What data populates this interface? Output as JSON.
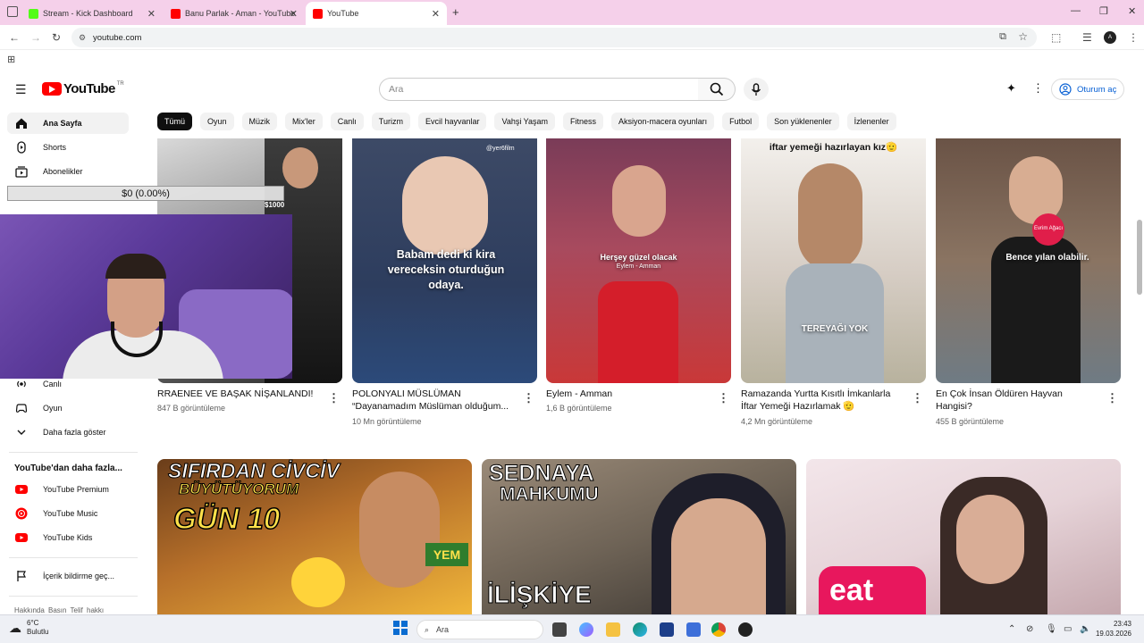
{
  "browser": {
    "tabs": [
      {
        "label": "Stream - Kick Dashboard",
        "favicon_color": "#53fc18",
        "active": false
      },
      {
        "label": "Banu Parlak - Aman - YouTube",
        "favicon_color": "#ff0000",
        "active": false
      },
      {
        "label": "YouTube",
        "favicon_color": "#ff0000",
        "active": true
      }
    ],
    "new_tab_icon": "plus-icon",
    "url": "youtube.com"
  },
  "header": {
    "logo_text": "YouTube",
    "country_code": "TR",
    "search_placeholder": "Ara",
    "sign_in_label": "Oturum aç"
  },
  "chips": [
    "Tümü",
    "Oyun",
    "Müzik",
    "Mix'ler",
    "Canlı",
    "Turizm",
    "Evcil hayvanlar",
    "Vahşi Yaşam",
    "Fitness",
    "Aksiyon-macera oyunları",
    "Futbol",
    "Son yüklenenler",
    "İzlenenler"
  ],
  "sidebar": {
    "top_items": [
      {
        "label": "Ana Sayfa",
        "icon": "home-icon"
      },
      {
        "label": "Shorts",
        "icon": "shorts-icon"
      },
      {
        "label": "Abonelikler",
        "icon": "subscriptions-icon"
      }
    ],
    "explore_items": [
      {
        "label": "Canlı",
        "icon": "live-icon"
      },
      {
        "label": "Oyun",
        "icon": "gaming-icon"
      },
      {
        "label": "Daha fazla göster",
        "icon": "chevron-down-icon"
      }
    ],
    "more_heading": "YouTube'dan daha fazla...",
    "more_items": [
      {
        "label": "YouTube Premium",
        "icon": "youtube-premium-icon"
      },
      {
        "label": "YouTube Music",
        "icon": "youtube-music-icon"
      },
      {
        "label": "YouTube Kids",
        "icon": "youtube-kids-icon"
      }
    ],
    "report_label": "İçerik bildirme geç...",
    "footer_links": "Hakkında  Basın  Telif hakkı"
  },
  "stream_overlay": {
    "donation_text": "$0 (0.00%)"
  },
  "videos_row1": [
    {
      "title": "RRAENEE VE BAŞAK NİŞANLANDI!",
      "views": "847 B görüntüleme",
      "overlay": "",
      "price": "$1000"
    },
    {
      "title": "POLONYALI MÜSLÜMAN “Dayanamadım Müslüman olduğum...",
      "views": "10 Mn görüntüleme",
      "overlay": "Babam dedi ki kira vereceksin oturduğun odaya.",
      "watermark": "@yer6film"
    },
    {
      "title": "Eylem - Amman",
      "views": "1,6 B görüntüleme",
      "overlay": "Herşey güzel olacak",
      "sub_overlay": "Eylem - Amman"
    },
    {
      "title": "Ramazanda Yurtta Kısıtlı İmkanlarla İftar Yemeği Hazırlamak 🫡",
      "views": "4,2 Mn görüntüleme",
      "overlay": "iftar yemeği hazırlayan kız🫡",
      "sub_overlay": "TEREYAĞI YOK"
    },
    {
      "title": "En Çok İnsan Öldüren Hayvan Hangisi?",
      "views": "455 B görüntüleme",
      "overlay": "Bence yılan olabilir.",
      "badge": "Evrim Ağacı"
    }
  ],
  "videos_row2": [
    {
      "overlay_lines": [
        "SIFIRDAN CİVCİV",
        "BÜYÜTÜYORUM",
        "GÜN 10"
      ],
      "sign": "YEM"
    },
    {
      "overlay_lines": [
        "SEDNAYA",
        "MAHKUMU",
        "İLİŞKİYE"
      ]
    },
    {
      "overlay_lines": [
        "eat"
      ]
    }
  ],
  "taskbar": {
    "weather_temp": "6°C",
    "weather_desc": "Bulutlu",
    "search_label": "Ara",
    "time": "23:43",
    "date": "19.03.2026"
  }
}
